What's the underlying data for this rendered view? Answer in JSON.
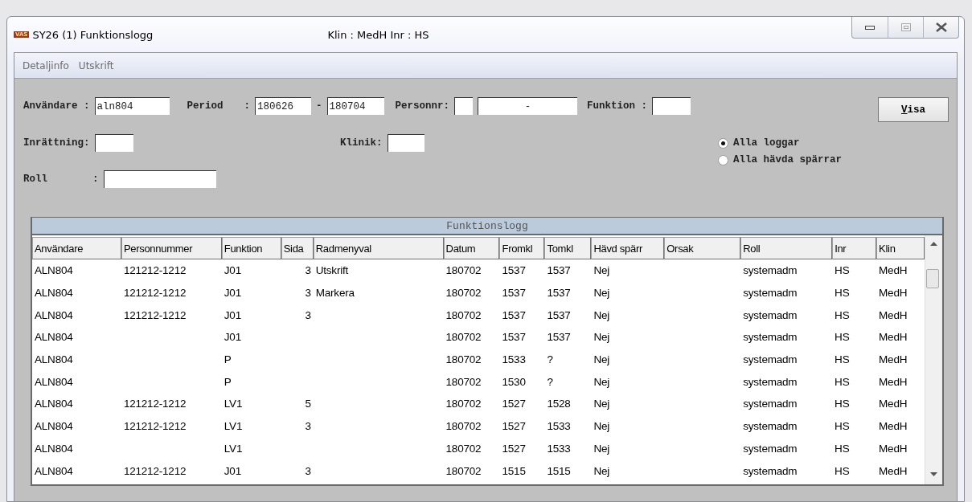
{
  "window": {
    "title": "SY26 (1) Funktionslogg",
    "context": "Klin : MedH  Inr : HS",
    "logo": "VAS"
  },
  "menu": [
    {
      "label": "Detaljinfo"
    },
    {
      "label": "Utskrift"
    }
  ],
  "filters": {
    "user_label": "Användare :",
    "user_value": "aln804",
    "period_label": "Period",
    "period_sep": ":",
    "period_from": "180626",
    "period_dash": "-",
    "period_to": "180704",
    "personnr_label": "Personnr:",
    "personnr_value": "-",
    "funktion_label": "Funktion :",
    "inrattning_label": "Inrättning:",
    "klinik_label": "Klinik:",
    "roll_label": "Roll",
    "roll_sep": ":",
    "button": "Visa"
  },
  "radios": [
    {
      "label": "Alla loggar",
      "selected": true
    },
    {
      "label": "Alla hävda spärrar",
      "selected": false
    }
  ],
  "table": {
    "title": "Funktionslogg",
    "columns": [
      "Användare",
      "Personnummer",
      "Funktion",
      "Sida",
      "Radmenyval",
      "Datum",
      "Fromkl",
      "Tomkl",
      "Hävd spärr",
      "Orsak",
      "Roll",
      "Inr",
      "Klin"
    ],
    "rows": [
      [
        "ALN804",
        "121212-1212",
        "J01",
        "3",
        "Utskrift",
        "180702",
        "1537",
        "1537",
        "Nej",
        "",
        "systemadm",
        "HS",
        "MedH"
      ],
      [
        "ALN804",
        "121212-1212",
        "J01",
        "3",
        "Markera",
        "180702",
        "1537",
        "1537",
        "Nej",
        "",
        "systemadm",
        "HS",
        "MedH"
      ],
      [
        "ALN804",
        "121212-1212",
        "J01",
        "3",
        "",
        "180702",
        "1537",
        "1537",
        "Nej",
        "",
        "systemadm",
        "HS",
        "MedH"
      ],
      [
        "ALN804",
        "",
        "J01",
        "",
        "",
        "180702",
        "1537",
        "1537",
        "Nej",
        "",
        "systemadm",
        "HS",
        "MedH"
      ],
      [
        "ALN804",
        "",
        "P",
        "",
        "",
        "180702",
        "1533",
        "?",
        "Nej",
        "",
        "systemadm",
        "HS",
        "MedH"
      ],
      [
        "ALN804",
        "",
        "P",
        "",
        "",
        "180702",
        "1530",
        "?",
        "Nej",
        "",
        "systemadm",
        "HS",
        "MedH"
      ],
      [
        "ALN804",
        "121212-1212",
        "LV1",
        "5",
        "",
        "180702",
        "1527",
        "1528",
        "Nej",
        "",
        "systemadm",
        "HS",
        "MedH"
      ],
      [
        "ALN804",
        "121212-1212",
        "LV1",
        "3",
        "",
        "180702",
        "1527",
        "1533",
        "Nej",
        "",
        "systemadm",
        "HS",
        "MedH"
      ],
      [
        "ALN804",
        "",
        "LV1",
        "",
        "",
        "180702",
        "1527",
        "1533",
        "Nej",
        "",
        "systemadm",
        "HS",
        "MedH"
      ],
      [
        "ALN804",
        "121212-1212",
        "J01",
        "3",
        "",
        "180702",
        "1515",
        "1515",
        "Nej",
        "",
        "systemadm",
        "HS",
        "MedH"
      ]
    ]
  }
}
